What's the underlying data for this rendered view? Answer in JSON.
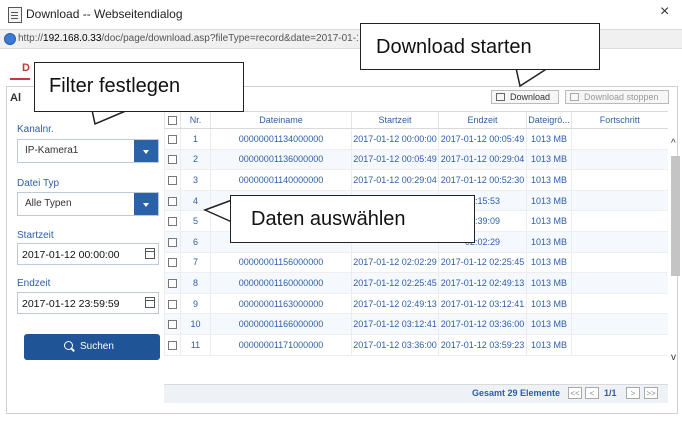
{
  "window": {
    "title": "Download -- Webseitendialog",
    "close_glyph": "×",
    "url_prefix": "http://",
    "url_host": "192.168.0.33",
    "url_rest": "/doc/page/download.asp?fileType=record&date=2017-01-12&"
  },
  "page": {
    "tab_fragment": "D",
    "heading_fragment": "Al"
  },
  "filter": {
    "channel_label": "Kanalnr.",
    "channel_value": "IP-Kamera1",
    "type_label": "Datei Typ",
    "type_value": "Alle Typen",
    "start_label": "Startzeit",
    "start_value": "2017-01-12 00:00:00",
    "end_label": "Endzeit",
    "end_value": "2017-01-12 23:59:59",
    "search_label": "Suchen"
  },
  "toolbar": {
    "download_label": "Download",
    "stop_label": "Download stoppen"
  },
  "table": {
    "headers": [
      "Nr.",
      "Dateiname",
      "Startzeit",
      "Endzeit",
      "Dateigrö...",
      "Fortschritt"
    ],
    "rows": [
      {
        "nr": "1",
        "name": "00000001134000000",
        "start": "2017-01-12 00:00:00",
        "end": "2017-01-12 00:05:49",
        "size": "1013 MB"
      },
      {
        "nr": "2",
        "name": "00000001136000000",
        "start": "2017-01-12 00:05:49",
        "end": "2017-01-12 00:29:04",
        "size": "1013 MB"
      },
      {
        "nr": "3",
        "name": "00000001140000000",
        "start": "2017-01-12 00:29:04",
        "end": "2017-01-12 00:52:30",
        "size": "1013 MB"
      },
      {
        "nr": "4",
        "name": "",
        "start": "",
        "end": "01:15:53",
        "size": "1013 MB"
      },
      {
        "nr": "5",
        "name": "",
        "start": "",
        "end": "01:39:09",
        "size": "1013 MB"
      },
      {
        "nr": "6",
        "name": "",
        "start": "",
        "end": "02:02:29",
        "size": "1013 MB"
      },
      {
        "nr": "7",
        "name": "00000001156000000",
        "start": "2017-01-12 02:02:29",
        "end": "2017-01-12 02:25:45",
        "size": "1013 MB"
      },
      {
        "nr": "8",
        "name": "00000001160000000",
        "start": "2017-01-12 02:25:45",
        "end": "2017-01-12 02:49:13",
        "size": "1013 MB"
      },
      {
        "nr": "9",
        "name": "00000001163000000",
        "start": "2017-01-12 02:49:13",
        "end": "2017-01-12 03:12:41",
        "size": "1013 MB"
      },
      {
        "nr": "10",
        "name": "00000001166000000",
        "start": "2017-01-12 03:12:41",
        "end": "2017-01-12 03:36:00",
        "size": "1013 MB"
      },
      {
        "nr": "11",
        "name": "00000001171000000",
        "start": "2017-01-12 03:36:00",
        "end": "2017-01-12 03:59:23",
        "size": "1013 MB"
      }
    ],
    "total_label": "Gesamt 29 Elemente",
    "page_label": "1/1",
    "nav_first": "<<",
    "nav_prev": "<",
    "nav_next": ">",
    "nav_last": ">>"
  },
  "callouts": {
    "filter": "Filter festlegen",
    "download": "Download starten",
    "select": "Daten auswählen"
  },
  "scrollbar": {
    "up_glyph": "^",
    "down_glyph": "v"
  }
}
